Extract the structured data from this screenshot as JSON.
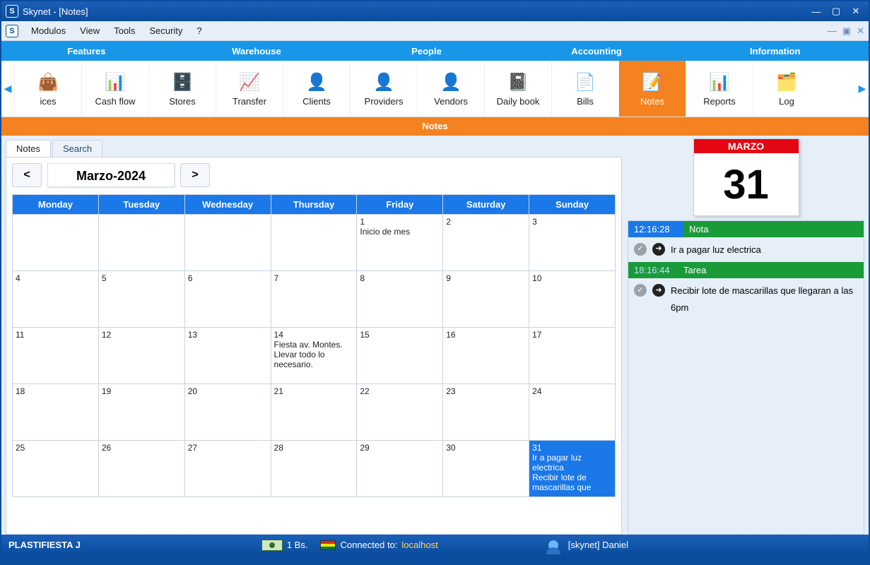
{
  "window": {
    "title": "Skynet - [Notes]"
  },
  "menu": {
    "items": [
      "Modulos",
      "View",
      "Tools",
      "Security",
      "?"
    ]
  },
  "sections": [
    "Features",
    "Warehouse",
    "People",
    "Accounting",
    "Information"
  ],
  "toolbar": {
    "scroll_left": "◀",
    "scroll_right": "▶",
    "items": [
      {
        "label": "ices",
        "icon": "👜"
      },
      {
        "label": "Cash flow",
        "icon": "📊"
      },
      {
        "label": "Stores",
        "icon": "🗄️"
      },
      {
        "label": "Transfer",
        "icon": "📈"
      },
      {
        "label": "Clients",
        "icon": "👤",
        "color": "#3bb54a"
      },
      {
        "label": "Providers",
        "icon": "👤",
        "color": "#1a78e8"
      },
      {
        "label": "Vendors",
        "icon": "👤",
        "color": "#f5a623"
      },
      {
        "label": "Daily book",
        "icon": "📓"
      },
      {
        "label": "Bills",
        "icon": "📄"
      },
      {
        "label": "Notes",
        "icon": "📝",
        "active": true
      },
      {
        "label": "Reports",
        "icon": "📊"
      },
      {
        "label": "Log",
        "icon": "🗂️"
      }
    ]
  },
  "page_title": "Notes",
  "tabs": {
    "notes": "Notes",
    "search": "Search"
  },
  "month_nav": {
    "prev": "<",
    "label": "Marzo-2024",
    "next": ">"
  },
  "weekdays": [
    "Monday",
    "Tuesday",
    "Wednesday",
    "Thursday",
    "Friday",
    "Saturday",
    "Sunday"
  ],
  "weeks": [
    [
      {
        "n": ""
      },
      {
        "n": ""
      },
      {
        "n": ""
      },
      {
        "n": ""
      },
      {
        "n": "1",
        "t": "Inicio de mes"
      },
      {
        "n": "2"
      },
      {
        "n": "3"
      }
    ],
    [
      {
        "n": "4"
      },
      {
        "n": "5"
      },
      {
        "n": "6"
      },
      {
        "n": "7"
      },
      {
        "n": "8"
      },
      {
        "n": "9"
      },
      {
        "n": "10"
      }
    ],
    [
      {
        "n": "11"
      },
      {
        "n": "12"
      },
      {
        "n": "13"
      },
      {
        "n": "14",
        "t": "Fiesta av. Montes. Llevar todo lo necesario."
      },
      {
        "n": "15"
      },
      {
        "n": "16"
      },
      {
        "n": "17"
      }
    ],
    [
      {
        "n": "18"
      },
      {
        "n": "19"
      },
      {
        "n": "20"
      },
      {
        "n": "21"
      },
      {
        "n": "22"
      },
      {
        "n": "23"
      },
      {
        "n": "24"
      }
    ],
    [
      {
        "n": "25"
      },
      {
        "n": "26"
      },
      {
        "n": "27"
      },
      {
        "n": "28"
      },
      {
        "n": "29"
      },
      {
        "n": "30"
      },
      {
        "n": "31",
        "t": "Ir a pagar luz electrica\nRecibir lote de mascarillas que",
        "sel": true
      }
    ]
  ],
  "day_card": {
    "month": "MARZO",
    "day": "31"
  },
  "notes_panel": [
    {
      "time": "12:16:28",
      "type": "Nota",
      "text": "Ir a pagar luz electrica"
    },
    {
      "time": "18:16:44",
      "type": "Tarea",
      "text": "Recibir lote de mascarillas que llegaran a las 6pm"
    }
  ],
  "status": {
    "company": "PLASTIFIESTA J",
    "rate": "1 Bs.",
    "connected_lbl": "Connected to: ",
    "connected_host": "localhost",
    "user": "[skynet] Daniel"
  }
}
